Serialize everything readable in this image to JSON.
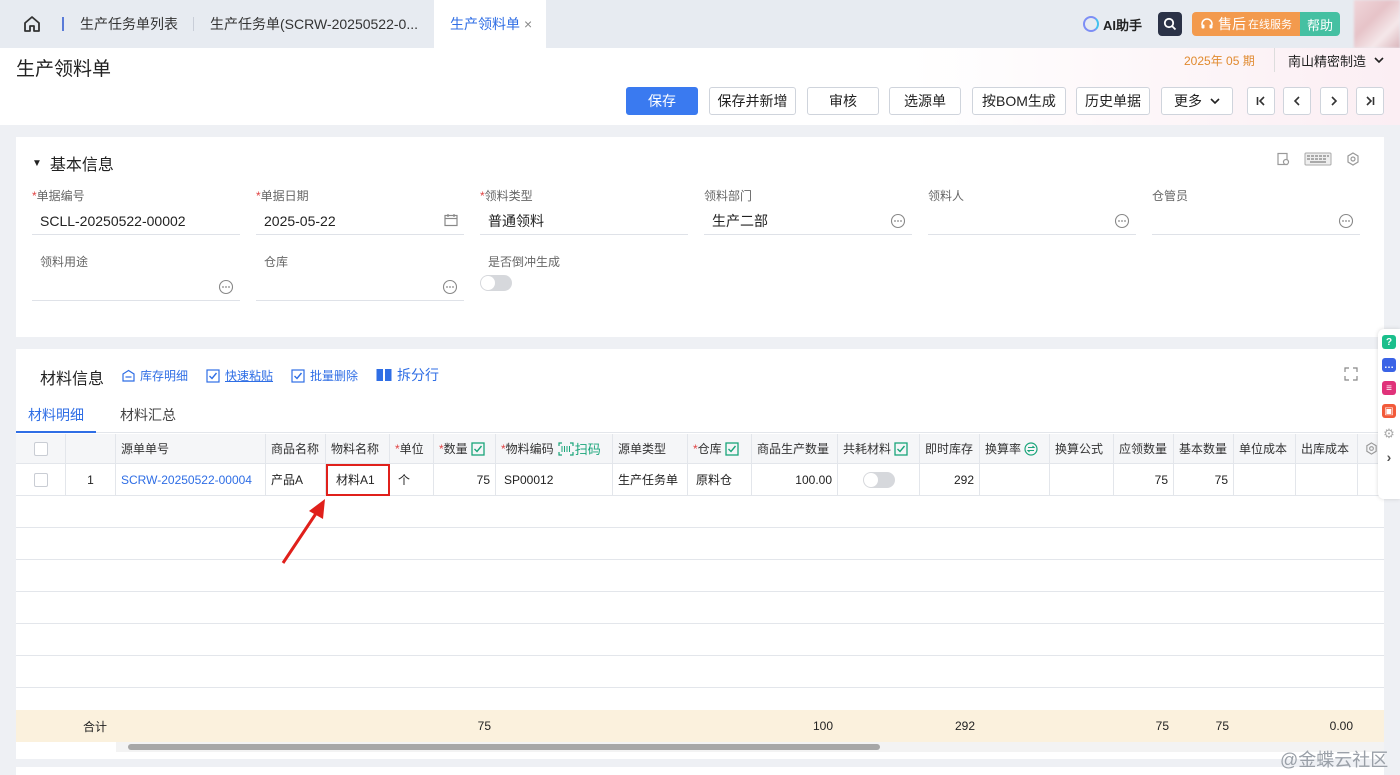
{
  "tabs": [
    {
      "label": "生产任务单列表"
    },
    {
      "label": "生产任务单(SCRW-20250522-0..."
    },
    {
      "label": "生产领料单",
      "close": "×"
    }
  ],
  "topright": {
    "ai_label": "AI助手",
    "service_label": "售后",
    "service_sub": "在线服务",
    "help_label": "帮助"
  },
  "header": {
    "title": "生产领料单",
    "period": "2025年 05 期",
    "org": "南山精密制造"
  },
  "toolbar": {
    "save": "保存",
    "save_new": "保存并新增",
    "audit": "审核",
    "select_source": "选源单",
    "bom": "按BOM生成",
    "history": "历史单据",
    "more": "更多"
  },
  "basic": {
    "title": "基本信息",
    "fields": [
      {
        "label": "单据编号",
        "required": true,
        "value": "SCLL-20250522-00002"
      },
      {
        "label": "单据日期",
        "required": true,
        "value": "2025-05-22"
      },
      {
        "label": "领料类型",
        "required": true,
        "value": "普通领料"
      },
      {
        "label": "领料部门",
        "required": false,
        "value": "生产二部"
      },
      {
        "label": "领料人",
        "required": false,
        "value": ""
      },
      {
        "label": "仓管员",
        "required": false,
        "value": ""
      },
      {
        "label": "领料用途",
        "required": false,
        "value": ""
      },
      {
        "label": "仓库",
        "required": false,
        "value": ""
      },
      {
        "label": "是否倒冲生成",
        "required": false,
        "value": ""
      }
    ]
  },
  "material": {
    "title": "材料信息",
    "links": [
      "库存明细",
      "快速粘贴",
      "批量删除",
      "拆分行"
    ],
    "subtabs": [
      "材料明细",
      "材料汇总"
    ],
    "columns": [
      "源单单号",
      "商品名称",
      "物料名称",
      "单位",
      "数量",
      "物料编码",
      "扫码",
      "源单类型",
      "仓库",
      "商品生产数量",
      "共耗材料",
      "即时库存",
      "换算率",
      "换算公式",
      "应领数量",
      "基本数量",
      "单位成本",
      "出库成本"
    ],
    "row": {
      "index": "1",
      "source_no": "SCRW-20250522-00004",
      "product": "产品A",
      "material": "材料A1",
      "unit": "个",
      "qty": "75",
      "code": "SP00012",
      "source_type": "生产任务单",
      "warehouse": "原料仓",
      "prod_qty": "100.00",
      "stock": "292",
      "due_qty": "75",
      "base_qty": "75"
    },
    "sum": {
      "label": "合计",
      "qty": "75",
      "prod_qty": "100",
      "stock": "292",
      "due_qty": "75",
      "base_qty": "75",
      "cost": "0.00"
    }
  },
  "watermark": "@金蝶云社区"
}
